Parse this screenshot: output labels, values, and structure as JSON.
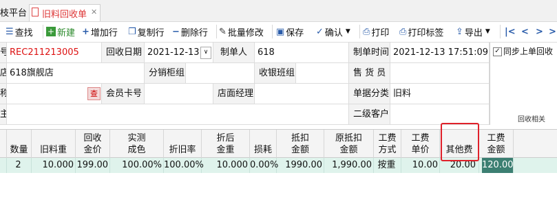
{
  "tabs": {
    "home": "枝平台",
    "active": "旧料回收单",
    "close": "✕"
  },
  "toolbar": {
    "find": "查找",
    "new": "新建",
    "add_row": "增加行",
    "copy_row": "复制行",
    "delete_row": "删除行",
    "bulk_edit": "批量修改",
    "save": "保存",
    "confirm": "确认",
    "print": "打印",
    "print_label": "打印标签",
    "export": "导出"
  },
  "form": {
    "r1": {
      "lbl0": "号",
      "order_no": "REC211213005",
      "lbl_date": "回收日期",
      "date": "2021-12-13",
      "lbl_maker": "制单人",
      "maker": "618",
      "lbl_time": "制单时间",
      "time": "2021-12-13 17:51:09"
    },
    "r2": {
      "lbl0": "店",
      "store": "618旗舰店",
      "lbl_counter": "分销柜组",
      "counter": "",
      "lbl_cashier": "收银班组",
      "cashier": "",
      "lbl_seller": "售 货 员",
      "seller": ""
    },
    "r3": {
      "lbl0": "称",
      "search_btn": "查",
      "lbl_member": "会员卡号",
      "member": "",
      "lbl_manager": "店面经理",
      "manager": "",
      "lbl_class": "单据分类",
      "class": "旧料"
    },
    "r4": {
      "lbl0": "主",
      "lbl_customer2": "二级客户",
      "customer2": ""
    },
    "side": {
      "sync_label": "同步上单回收",
      "sync_checked": true,
      "section": "回收相关"
    }
  },
  "grid": {
    "headers": [
      "数量",
      "旧料重",
      "回收\n金价",
      "实测\n成色",
      "折旧率",
      "折后\n金重",
      "损耗",
      "抵扣\n金额",
      "原抵扣\n金额",
      "工费\n方式",
      "工费\n单价",
      "其他费",
      "工费\n金额"
    ],
    "rows": [
      [
        "2",
        "10.000",
        "199.00",
        "100.00%",
        "100.00%",
        "10.000",
        "0.00%",
        "1990.00",
        "1,990.00",
        "按重",
        "10.00",
        "20.00",
        "120.00"
      ]
    ]
  },
  "colors": {
    "row_bg": "#dff3ec",
    "highlight": "#e0202a",
    "selected_cell": "#3c7f72"
  }
}
